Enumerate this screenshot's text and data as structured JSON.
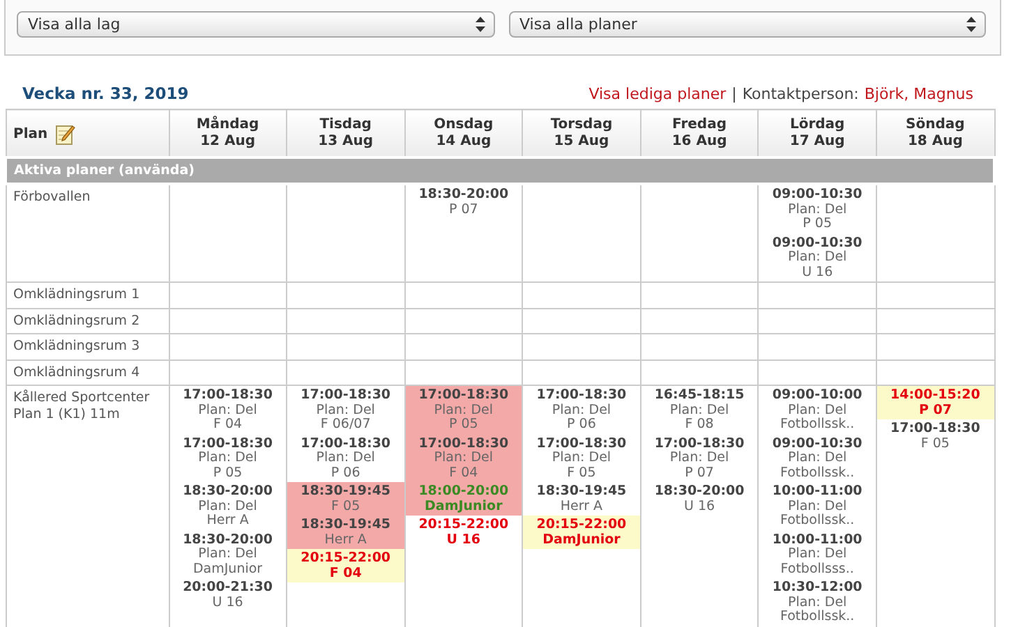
{
  "filters": [
    {
      "value": "Visa alla lag"
    },
    {
      "value": "Visa alla planer"
    }
  ],
  "header": {
    "week_title": "Vecka nr. 33, 2019",
    "free_link": "Visa lediga planer",
    "separator": "|",
    "contact_label": "Kontaktperson:",
    "contact_name": "Björk, Magnus"
  },
  "table": {
    "plan_heading": "Plan",
    "days": [
      {
        "name": "Måndag",
        "date": "12 Aug"
      },
      {
        "name": "Tisdag",
        "date": "13 Aug"
      },
      {
        "name": "Onsdag",
        "date": "14 Aug"
      },
      {
        "name": "Torsdag",
        "date": "15 Aug"
      },
      {
        "name": "Fredag",
        "date": "16 Aug"
      },
      {
        "name": "Lördag",
        "date": "17 Aug"
      },
      {
        "name": "Söndag",
        "date": "18 Aug"
      }
    ],
    "section": "Aktiva planer (använda)",
    "rows": [
      {
        "name": "Förbovallen",
        "cells": [
          [],
          [],
          [
            {
              "kind": "normal",
              "time": "18:30-20:00",
              "lines": [
                "P 07"
              ]
            }
          ],
          [],
          [],
          [
            {
              "kind": "normal",
              "time": "09:00-10:30",
              "lines": [
                "Plan: Del",
                "P 05"
              ]
            },
            {
              "kind": "normal",
              "time": "09:00-10:30",
              "lines": [
                "Plan: Del",
                "U 16"
              ]
            }
          ],
          []
        ]
      },
      {
        "name": "Omklädningsrum 1",
        "cells": [
          [],
          [],
          [],
          [],
          [],
          [],
          []
        ]
      },
      {
        "name": "Omklädningsrum 2",
        "cells": [
          [],
          [],
          [],
          [],
          [],
          [],
          []
        ]
      },
      {
        "name": "Omklädningsrum 3",
        "cells": [
          [],
          [],
          [],
          [],
          [],
          [],
          []
        ]
      },
      {
        "name": "Omklädningsrum 4",
        "cells": [
          [],
          [],
          [],
          [],
          [],
          [],
          []
        ]
      },
      {
        "name": "Kållered Sportcenter Plan 1 (K1) 11m",
        "cells": [
          [
            {
              "kind": "normal",
              "time": "17:00-18:30",
              "lines": [
                "Plan: Del",
                "F 04"
              ]
            },
            {
              "kind": "normal",
              "time": "17:00-18:30",
              "lines": [
                "Plan: Del",
                "P 05"
              ]
            },
            {
              "kind": "normal",
              "time": "18:30-20:00",
              "lines": [
                "Plan: Del",
                "Herr A"
              ]
            },
            {
              "kind": "normal",
              "time": "18:30-20:00",
              "lines": [
                "Plan: Del",
                "DamJunior"
              ]
            },
            {
              "kind": "normal",
              "time": "20:00-21:30",
              "lines": [
                "U 16"
              ]
            }
          ],
          [
            {
              "kind": "normal",
              "time": "17:00-18:30",
              "lines": [
                "Plan: Del",
                "F 06/07"
              ]
            },
            {
              "kind": "normal",
              "time": "17:00-18:30",
              "lines": [
                "Plan: Del",
                "P 06"
              ]
            },
            {
              "kind": "overlap",
              "time": "18:30-19:45",
              "lines": [
                "F 05"
              ]
            },
            {
              "kind": "overlap",
              "time": "18:30-19:45",
              "lines": [
                "Herr A"
              ]
            },
            {
              "kind": "request",
              "time": "20:15-22:00",
              "lines": [
                "F 04"
              ]
            }
          ],
          [
            {
              "kind": "overlap",
              "time": "17:00-18:30",
              "lines": [
                "Plan: Del",
                "P 05"
              ]
            },
            {
              "kind": "overlap",
              "time": "17:00-18:30",
              "lines": [
                "Plan: Del",
                "F 04"
              ]
            },
            {
              "kind": "overlap_green",
              "time": "18:00-20:00",
              "lines": [
                "DamJunior"
              ]
            },
            {
              "kind": "red",
              "time": "20:15-22:00",
              "lines": [
                "U 16"
              ]
            }
          ],
          [
            {
              "kind": "normal",
              "time": "17:00-18:30",
              "lines": [
                "Plan: Del",
                "P 06"
              ]
            },
            {
              "kind": "normal",
              "time": "17:00-18:30",
              "lines": [
                "Plan: Del",
                "F 05"
              ]
            },
            {
              "kind": "normal",
              "time": "18:30-19:45",
              "lines": [
                "Herr A"
              ]
            },
            {
              "kind": "request",
              "time": "20:15-22:00",
              "lines": [
                "DamJunior"
              ]
            }
          ],
          [
            {
              "kind": "normal",
              "time": "16:45-18:15",
              "lines": [
                "Plan: Del",
                "F 08"
              ]
            },
            {
              "kind": "normal",
              "time": "17:00-18:30",
              "lines": [
                "Plan: Del",
                "P 07"
              ]
            },
            {
              "kind": "normal",
              "time": "18:30-20:00",
              "lines": [
                "U 16"
              ]
            }
          ],
          [
            {
              "kind": "normal",
              "time": "09:00-10:00",
              "lines": [
                "Plan: Del",
                "Fotbollssk.."
              ]
            },
            {
              "kind": "normal",
              "time": "09:00-10:30",
              "lines": [
                "Plan: Del",
                "Fotbollssk.."
              ]
            },
            {
              "kind": "normal",
              "time": "10:00-11:00",
              "lines": [
                "Plan: Del",
                "Fotbollssk.."
              ]
            },
            {
              "kind": "normal",
              "time": "10:00-11:00",
              "lines": [
                "Plan: Del",
                "Fotbollsss.."
              ]
            },
            {
              "kind": "normal",
              "time": "10:30-12:00",
              "lines": [
                "Plan: Del",
                "Fotbollssk.."
              ]
            }
          ],
          [
            {
              "kind": "request",
              "time": "14:00-15:20",
              "lines": [
                "P 07"
              ]
            },
            {
              "kind": "normal",
              "time": "17:00-18:30",
              "lines": [
                "F 05"
              ]
            }
          ]
        ]
      }
    ]
  }
}
